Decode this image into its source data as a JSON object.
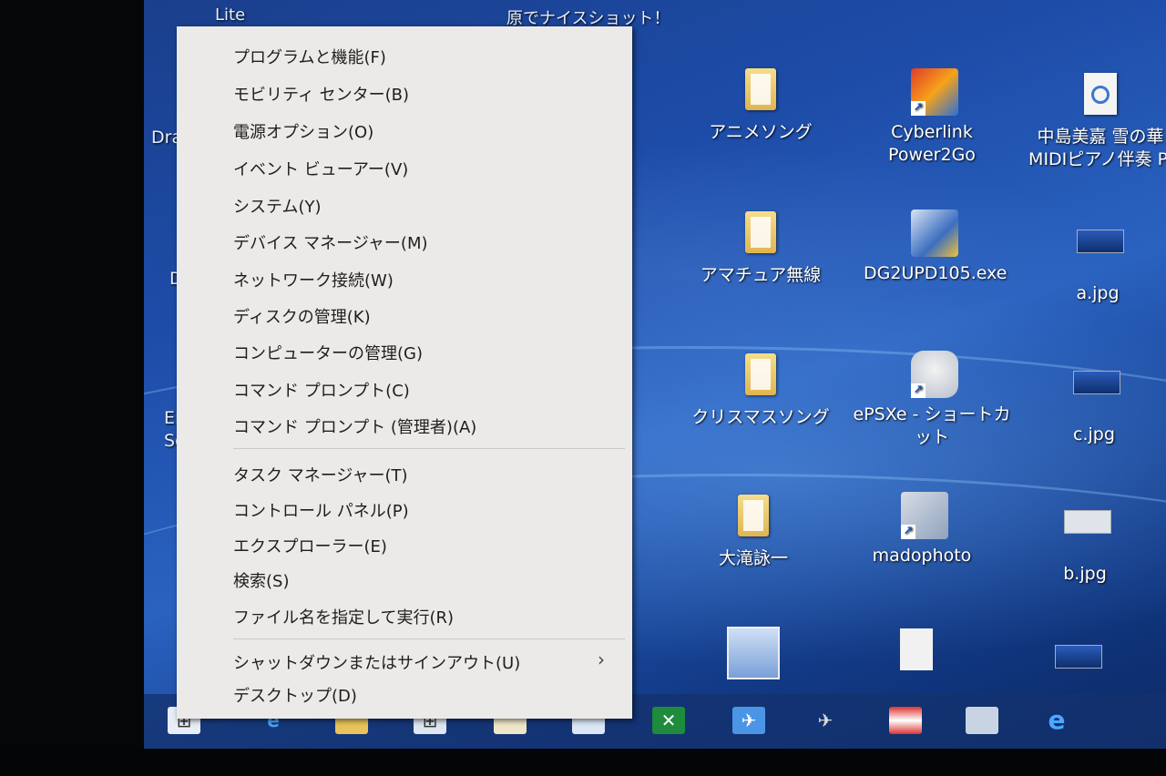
{
  "top_labels": [
    "Lite",
    "原でナイスショット！"
  ],
  "left_partials": [
    "Dra",
    "D",
    "EP",
    "Se"
  ],
  "menu": {
    "items": [
      "プログラムと機能(F)",
      "モビリティ センター(B)",
      "電源オプション(O)",
      "イベント ビューアー(V)",
      "システム(Y)",
      "デバイス マネージャー(M)",
      "ネットワーク接続(W)",
      "ディスクの管理(K)",
      "コンピューターの管理(G)",
      "コマンド プロンプト(C)",
      "コマンド プロンプト (管理者)(A)",
      "タスク マネージャー(T)",
      "コントロール パネル(P)",
      "エクスプローラー(E)",
      "検索(S)",
      "ファイル名を指定して実行(R)",
      "シャットダウンまたはサインアウト(U)",
      "デスクトップ(D)"
    ],
    "submenu_chevron": "›"
  },
  "desktop_icons": [
    {
      "label": "アニメソング",
      "icon": "folder-icon"
    },
    {
      "label": "Cyberlink Power2Go",
      "icon": "power2go-icon"
    },
    {
      "label": "中島美嘉 雪の華 MIDIピアノ伴奏 Pi",
      "icon": "audio-file-icon"
    },
    {
      "label": "アマチュア無線",
      "icon": "folder-icon"
    },
    {
      "label": "DG2UPD105.exe",
      "icon": "installer-icon"
    },
    {
      "label": "a.jpg",
      "icon": "image-icon"
    },
    {
      "label": "クリスマスソング",
      "icon": "folder-icon"
    },
    {
      "label": "ePSXe - ショートカット",
      "icon": "gamepad-icon"
    },
    {
      "label": "c.jpg",
      "icon": "image-icon"
    },
    {
      "label": "大滝詠一",
      "icon": "folder-icon"
    },
    {
      "label": "madophoto",
      "icon": "photos-icon"
    },
    {
      "label": "b.jpg",
      "icon": "image-icon"
    }
  ],
  "taskbar": {
    "items": [
      "start-button",
      "ie-icon",
      "explorer-icon",
      "store-icon",
      "notepad-icon",
      "app-icon",
      "excel-icon",
      "flight-icon",
      "plane-icon",
      "flag-icon",
      "window-icon",
      "ie-icon"
    ]
  }
}
